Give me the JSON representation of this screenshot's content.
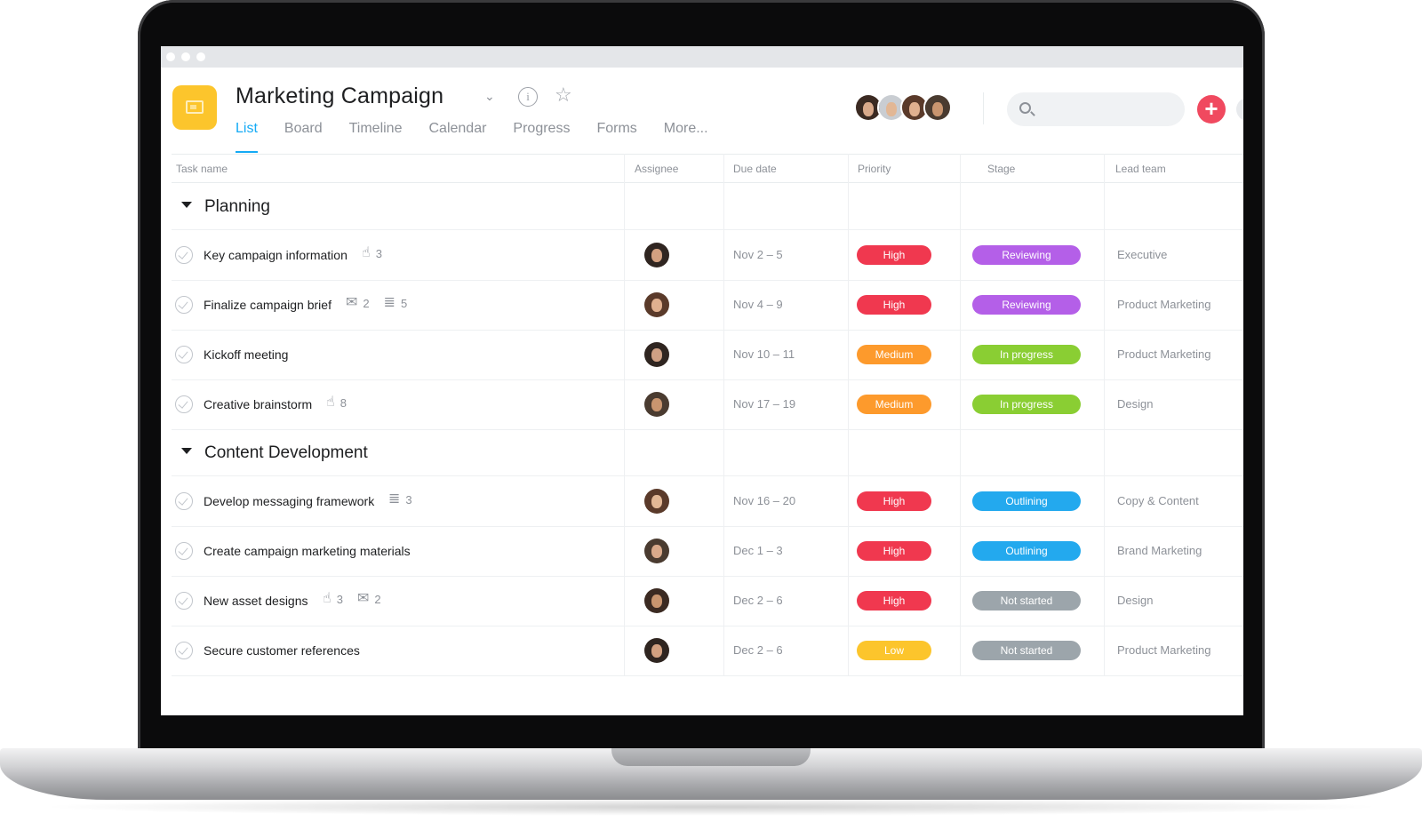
{
  "colors": {
    "accent": "#14aaf5",
    "project_icon": "#fcc52c",
    "add_button": "#f0495f",
    "priority": {
      "High": "#f0384f",
      "Medium": "#fd9a2c",
      "Low": "#fcc52c"
    },
    "stage": {
      "Reviewing": "#b45fe8",
      "In progress": "#8ace33",
      "Outlining": "#23a9ee",
      "Not started": "#9ca5ab"
    }
  },
  "header": {
    "title": "Marketing Campaign",
    "dropdown_icon": "chevron-down-icon",
    "info_icon": "info-icon",
    "favorite_icon": "star-icon",
    "tabs": [
      {
        "label": "List",
        "active": true
      },
      {
        "label": "Board",
        "active": false
      },
      {
        "label": "Timeline",
        "active": false
      },
      {
        "label": "Calendar",
        "active": false
      },
      {
        "label": "Progress",
        "active": false
      },
      {
        "label": "Forms",
        "active": false
      },
      {
        "label": "More...",
        "active": false
      }
    ],
    "members": [
      "member-avatar-1",
      "member-avatar-2",
      "member-avatar-3",
      "member-avatar-4"
    ],
    "search": {
      "placeholder": "",
      "icon": "search-icon"
    },
    "add_button": "+"
  },
  "table": {
    "columns": [
      "Task name",
      "Assignee",
      "Due date",
      "Priority",
      "Stage",
      "Lead team"
    ],
    "sections": [
      {
        "title": "Planning",
        "tasks": [
          {
            "name": "Key campaign information",
            "meta": [
              {
                "icon": "thumbs-up-icon",
                "count": "3"
              }
            ],
            "due": "Nov 2 – 5",
            "priority": "High",
            "stage": "Reviewing",
            "team": "Executive"
          },
          {
            "name": "Finalize campaign brief",
            "meta": [
              {
                "icon": "comment-icon",
                "count": "2"
              },
              {
                "icon": "subtask-icon",
                "count": "5"
              }
            ],
            "due": "Nov 4 – 9",
            "priority": "High",
            "stage": "Reviewing",
            "team": "Product Marketing"
          },
          {
            "name": "Kickoff meeting",
            "meta": [],
            "due": "Nov 10 – 11",
            "priority": "Medium",
            "stage": "In progress",
            "team": "Product Marketing"
          },
          {
            "name": "Creative brainstorm",
            "meta": [
              {
                "icon": "thumbs-up-icon",
                "count": "8"
              }
            ],
            "due": "Nov 17 – 19",
            "priority": "Medium",
            "stage": "In progress",
            "team": "Design"
          }
        ]
      },
      {
        "title": "Content Development",
        "tasks": [
          {
            "name": "Develop messaging framework",
            "meta": [
              {
                "icon": "subtask-icon",
                "count": "3"
              }
            ],
            "due": "Nov 16 – 20",
            "priority": "High",
            "stage": "Outlining",
            "team": "Copy & Content"
          },
          {
            "name": "Create campaign marketing materials",
            "meta": [],
            "due": "Dec 1 – 3",
            "priority": "High",
            "stage": "Outlining",
            "team": "Brand Marketing"
          },
          {
            "name": "New asset designs",
            "meta": [
              {
                "icon": "thumbs-up-icon",
                "count": "3"
              },
              {
                "icon": "comment-icon",
                "count": "2"
              }
            ],
            "due": "Dec 2 – 6",
            "priority": "High",
            "stage": "Not started",
            "team": "Design"
          },
          {
            "name": "Secure customer references",
            "meta": [],
            "due": "Dec 2 – 6",
            "priority": "Low",
            "stage": "Not started",
            "team": "Product Marketing"
          }
        ]
      }
    ]
  }
}
